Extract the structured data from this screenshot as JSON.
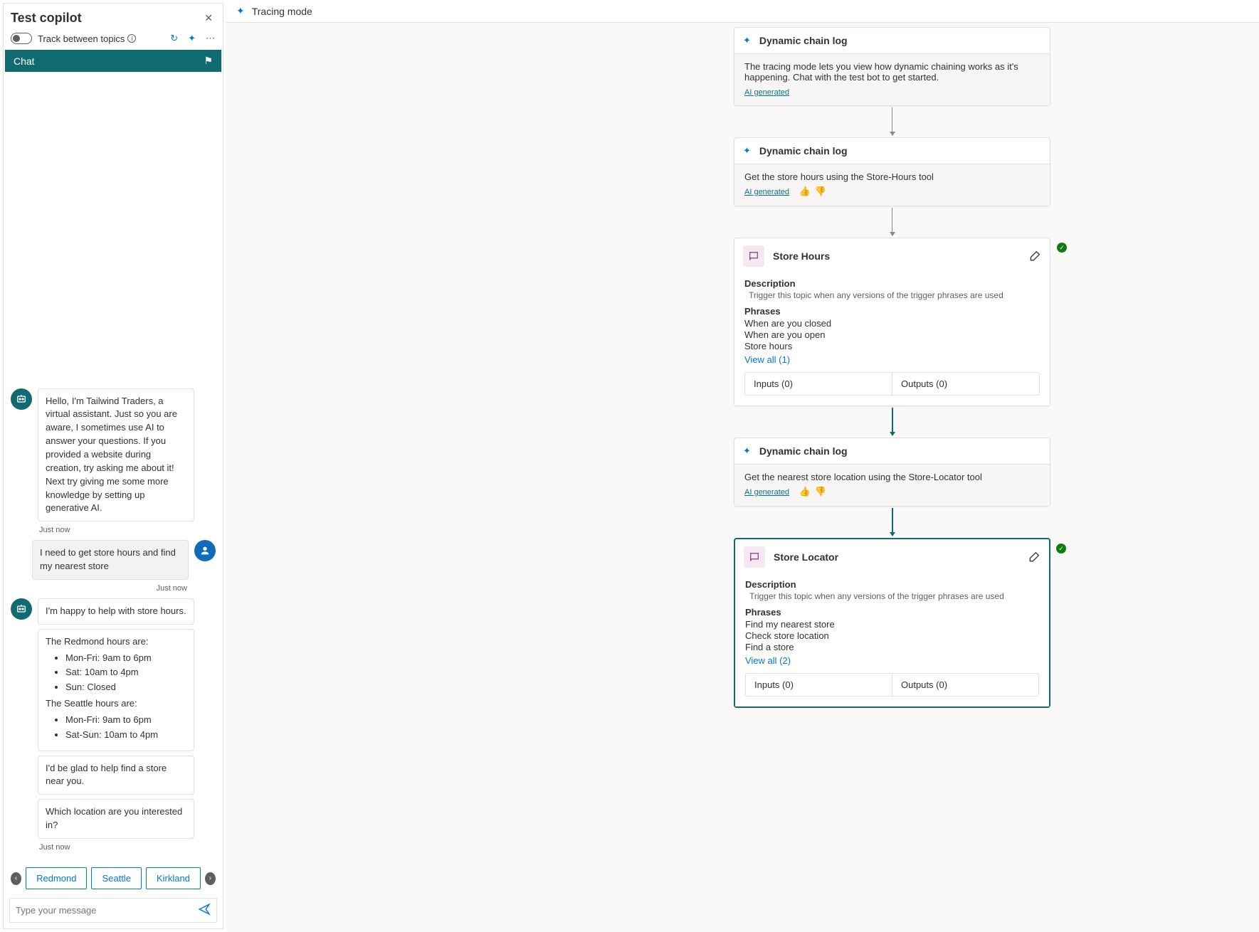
{
  "panel": {
    "title": "Test copilot",
    "track_label": "Track between topics",
    "chat_tab": "Chat",
    "input_placeholder": "Type your message"
  },
  "messages": {
    "bot_greeting": "Hello, I'm Tailwind Traders, a virtual assistant. Just so you are aware, I sometimes use AI to answer your questions. If you provided a website during creation, try asking me about it! Next try giving me some more knowledge by setting up generative AI.",
    "ts1": "Just now",
    "user_msg": "I need to get store hours and find my nearest store",
    "ts2": "Just now",
    "bot_help": "I'm happy to help with store hours.",
    "redmond_label": "The Redmond hours are:",
    "redmond_hours": [
      "Mon-Fri: 9am to 6pm",
      "Sat: 10am to 4pm",
      "Sun: Closed"
    ],
    "seattle_label": "The Seattle hours are:",
    "seattle_hours": [
      "Mon-Fri: 9am to 6pm",
      "Sat-Sun: 10am to 4pm"
    ],
    "bot_glad": "I'd be glad to help find a store near you.",
    "bot_which": "Which location are you interested in?",
    "ts3": "Just now",
    "suggestions": [
      "Redmond",
      "Seattle",
      "Kirkland"
    ]
  },
  "trace": {
    "header": "Tracing mode",
    "node1": {
      "title": "Dynamic chain log",
      "body": "The tracing mode lets you view how dynamic chaining works as it's happening. Chat with the test bot to get started.",
      "ai": "AI generated"
    },
    "node2": {
      "title": "Dynamic chain log",
      "body": "Get the store hours using the Store-Hours tool",
      "ai": "AI generated"
    },
    "storeHours": {
      "title": "Store Hours",
      "desc_label": "Description",
      "desc": "Trigger this topic when any versions of the trigger phrases are used",
      "phr_label": "Phrases",
      "phrases": [
        "When are you closed",
        "When are you open",
        "Store hours"
      ],
      "view_all": "View all (1)",
      "inputs": "Inputs (0)",
      "outputs": "Outputs (0)"
    },
    "node4": {
      "title": "Dynamic chain log",
      "body": "Get the nearest store location using the Store-Locator tool",
      "ai": "AI generated"
    },
    "storeLocator": {
      "title": "Store Locator",
      "desc_label": "Description",
      "desc": "Trigger this topic when any versions of the trigger phrases are used",
      "phr_label": "Phrases",
      "phrases": [
        "Find my nearest store",
        "Check store location",
        "Find a store"
      ],
      "view_all": "View all (2)",
      "inputs": "Inputs (0)",
      "outputs": "Outputs (0)"
    }
  }
}
